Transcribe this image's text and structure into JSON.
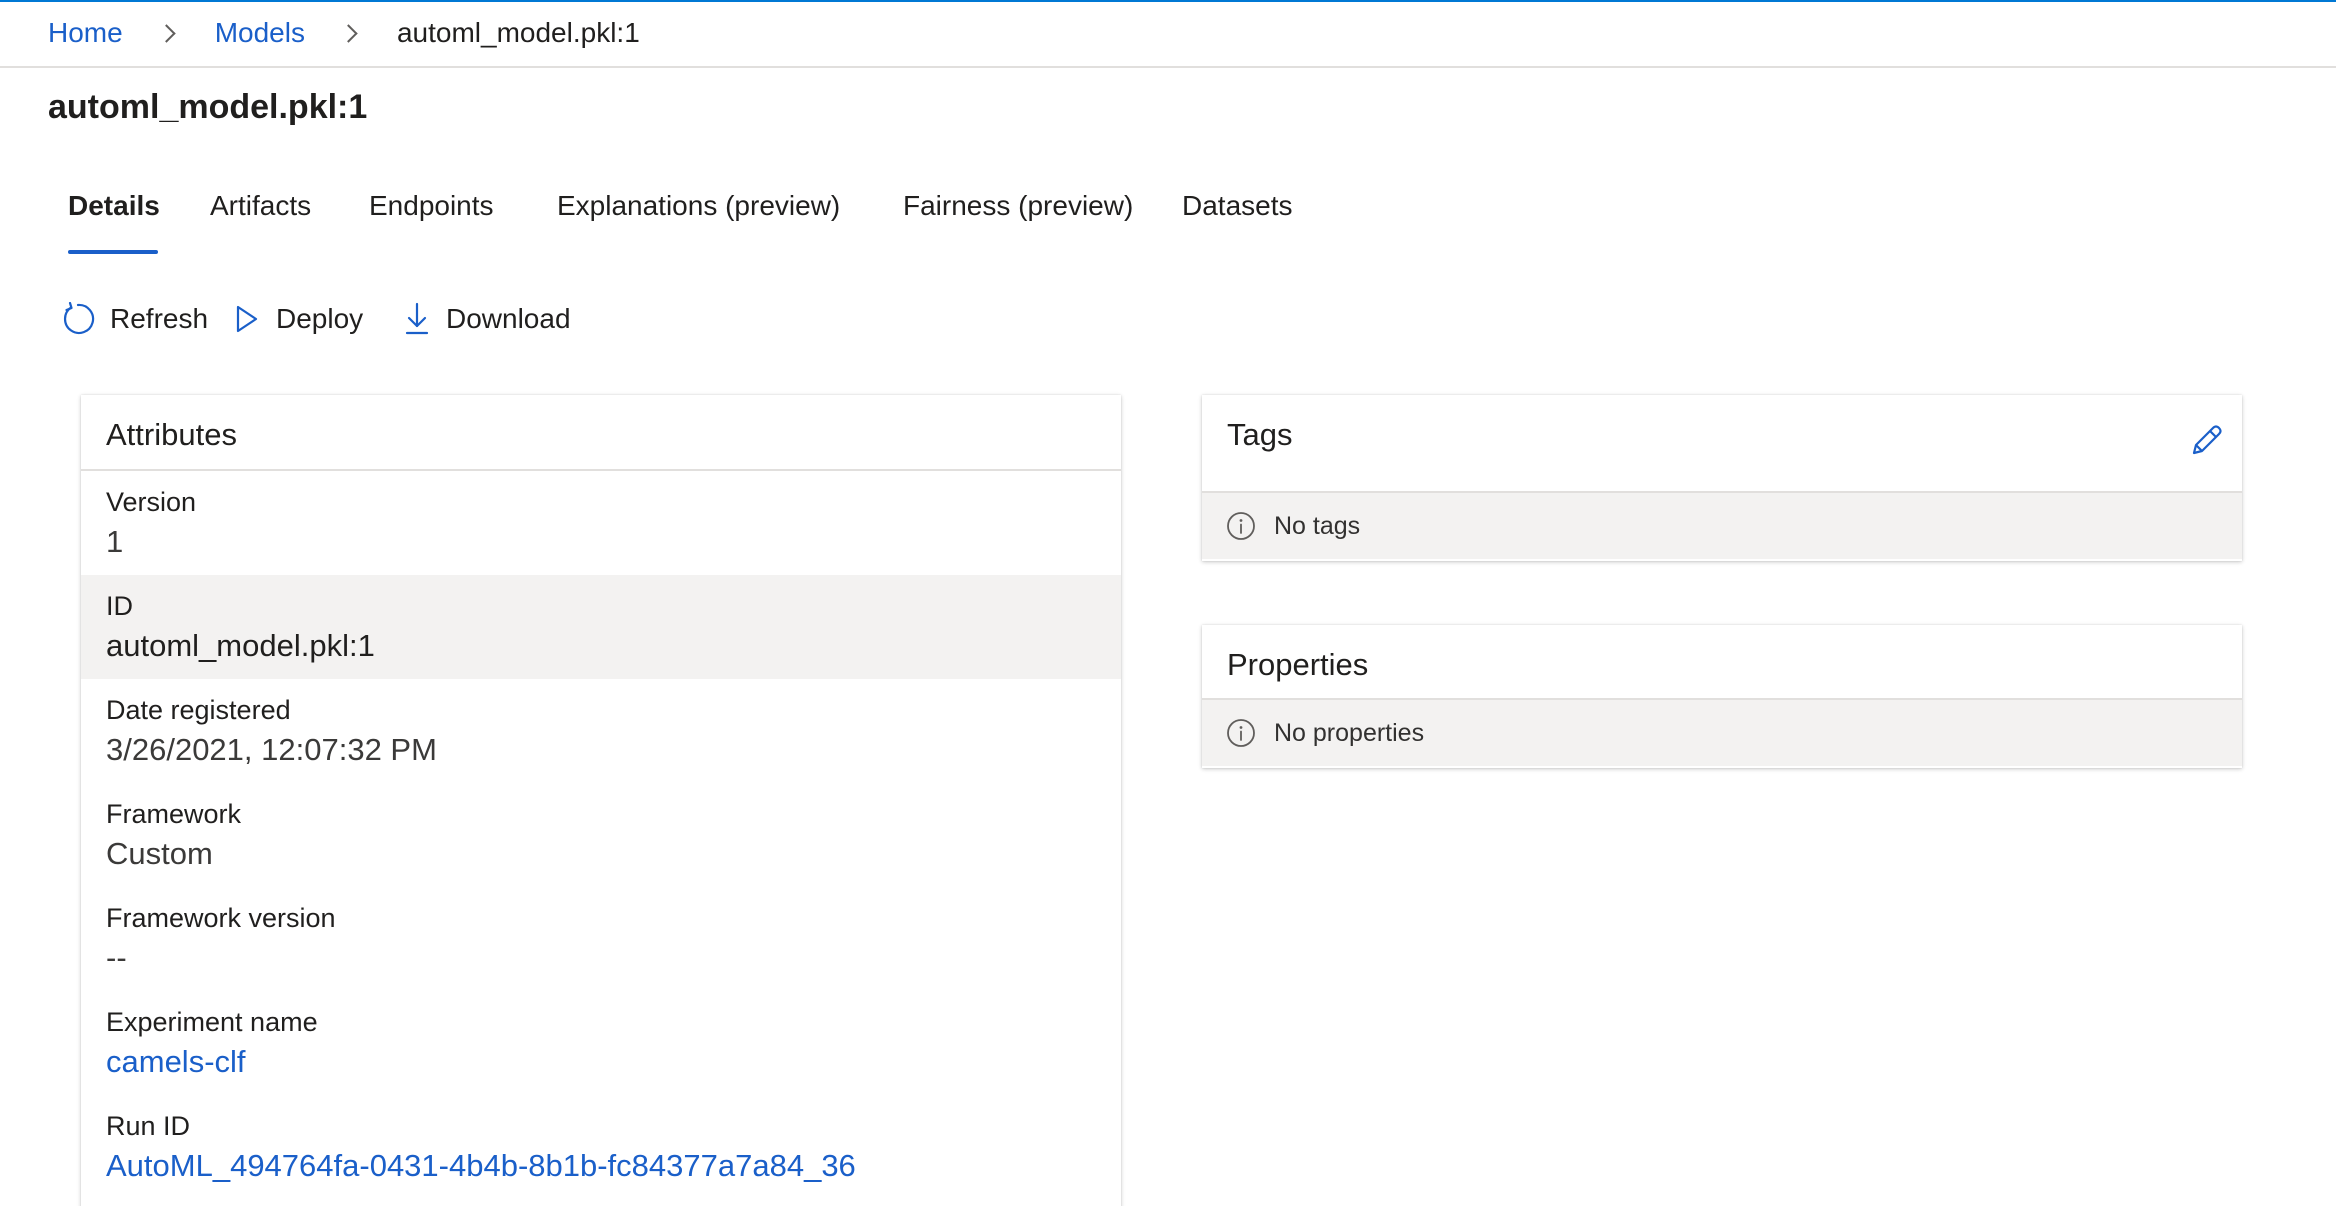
{
  "breadcrumb": {
    "items": [
      "Home",
      "Models"
    ],
    "current": "automl_model.pkl:1"
  },
  "page": {
    "title": "automl_model.pkl:1"
  },
  "tabs": [
    {
      "label": "Details",
      "active": true
    },
    {
      "label": "Artifacts",
      "active": false
    },
    {
      "label": "Endpoints",
      "active": false
    },
    {
      "label": "Explanations (preview)",
      "active": false
    },
    {
      "label": "Fairness (preview)",
      "active": false
    },
    {
      "label": "Datasets",
      "active": false
    }
  ],
  "toolbar": {
    "refresh_label": "Refresh",
    "deploy_label": "Deploy",
    "download_label": "Download"
  },
  "attributes": {
    "title": "Attributes",
    "rows": [
      {
        "label": "Version",
        "value": "1"
      },
      {
        "label": "ID",
        "value": "automl_model.pkl:1"
      },
      {
        "label": "Date registered",
        "value": "3/26/2021, 12:07:32 PM"
      },
      {
        "label": "Framework",
        "value": "Custom"
      },
      {
        "label": "Framework version",
        "value": "--"
      },
      {
        "label": "Experiment name",
        "value": "camels-clf"
      },
      {
        "label": "Run ID",
        "value": "AutoML_494764fa-0431-4b4b-8b1b-fc84377a7a84_36"
      }
    ]
  },
  "tags": {
    "title": "Tags",
    "empty_text": "No tags"
  },
  "properties": {
    "title": "Properties",
    "empty_text": "No properties"
  },
  "icons": {
    "refresh": "refresh-icon",
    "deploy": "play-icon",
    "download": "download-icon",
    "edit": "pencil-icon",
    "info": "info-icon",
    "chevron": "chevron-right-icon"
  },
  "colors": {
    "accent": "#1a5fc9",
    "shaded_row": "#f3f2f1",
    "text": "#201f1e"
  }
}
